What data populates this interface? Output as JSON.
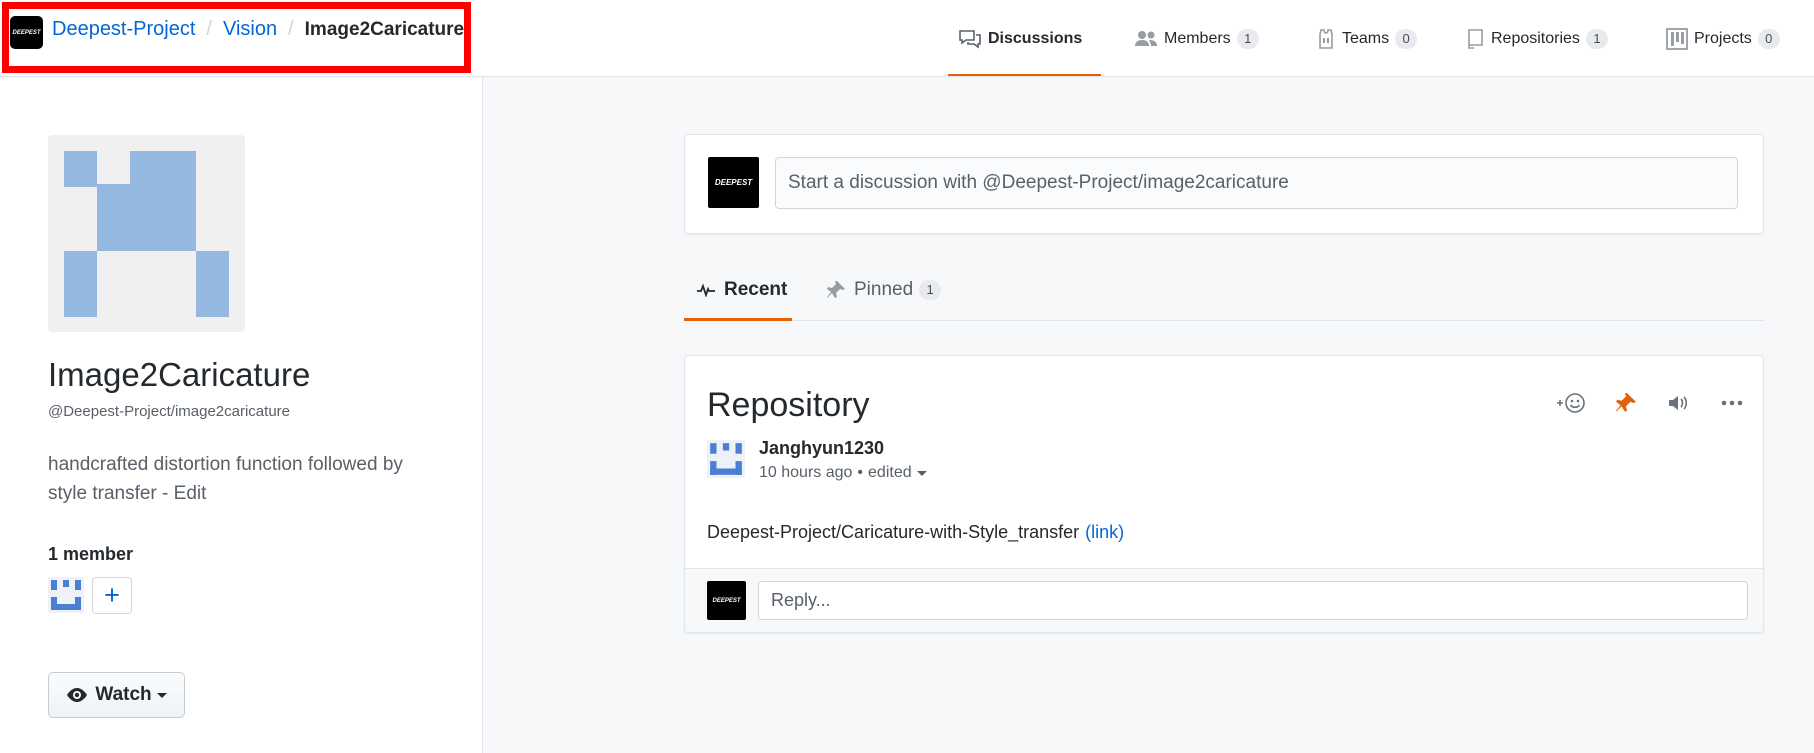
{
  "header": {
    "org_logo_text": "DEEPEST",
    "breadcrumb": {
      "org": "Deepest-Project",
      "parent_team": "Vision",
      "team": "Image2Caricature"
    },
    "nav": [
      {
        "label": "Discussions",
        "icon": "discussion-icon",
        "count": null,
        "active": true
      },
      {
        "label": "Members",
        "icon": "people-icon",
        "count": "1"
      },
      {
        "label": "Teams",
        "icon": "jersey-icon",
        "count": "0"
      },
      {
        "label": "Repositories",
        "icon": "repo-icon",
        "count": "1"
      },
      {
        "label": "Projects",
        "icon": "project-icon",
        "count": "0"
      }
    ],
    "accent_color": "#e36209",
    "highlight_color": "#ff0000"
  },
  "sidebar": {
    "team_name": "Image2Caricature",
    "team_handle": "@Deepest-Project/image2caricature",
    "description": "handcrafted distortion function followed by style transfer - Edit",
    "member_count": "1 member",
    "add_member_label": "+",
    "watch_label": "Watch"
  },
  "composer": {
    "logo_text": "DEEPEST",
    "placeholder": "Start a discussion with @Deepest-Project/image2caricature"
  },
  "tabs": [
    {
      "label": "Recent",
      "icon": "pulse-icon",
      "active": true
    },
    {
      "label": "Pinned",
      "icon": "pin-icon",
      "count": "1"
    }
  ],
  "post": {
    "title": "Repository",
    "author": "Janghyun1230",
    "time": "10 hours ago",
    "edited": "edited",
    "body_text": "Deepest-Project/Caricature-with-Style_transfer",
    "body_link": "(link)",
    "reply_placeholder": "Reply...",
    "logo_text": "DEEPEST"
  }
}
